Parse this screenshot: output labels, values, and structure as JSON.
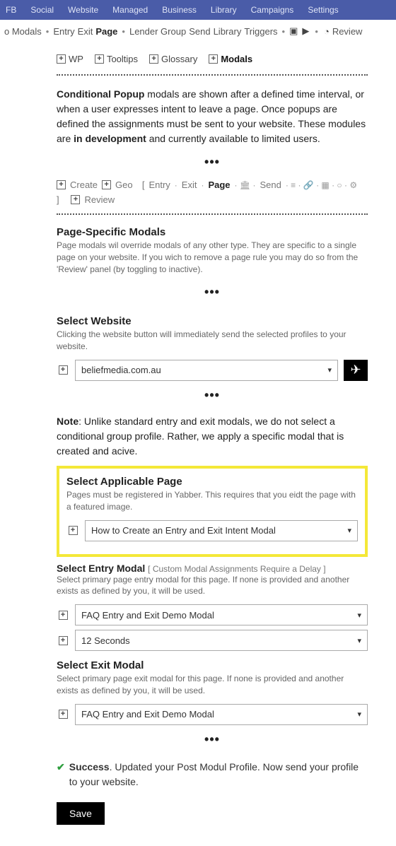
{
  "topnav": [
    "FB",
    "Social",
    "Website",
    "Managed",
    "Business",
    "Library",
    "Campaigns",
    "Settings"
  ],
  "subnav": {
    "left_trunc": "o Modals",
    "items": [
      "Entry",
      "Exit",
      "Page",
      "Lender Group",
      "Send",
      "Library",
      "Triggers"
    ],
    "active": "Page",
    "review": "Review"
  },
  "tabs": {
    "items": [
      "WP",
      "Tooltips",
      "Glossary",
      "Modals"
    ],
    "active": "Modals"
  },
  "intro": {
    "bold1": "Conditional Popup",
    "text1": " modals are shown after a defined time interval, or when a user expresses intent to leave a page. Once popups are defined the assignments must be sent to your website. These modules are ",
    "bold2": "in development",
    "text2": " and currently available to limited users."
  },
  "toolrow": {
    "create": "Create",
    "geo": "Geo",
    "entry": "Entry",
    "exit": "Exit",
    "page": "Page",
    "send": "Send",
    "review": "Review"
  },
  "page_specific": {
    "title": "Page-Specific Modals",
    "help": "Page modals wil override modals of any other type. They are specific to a single page on your website. If you wich to remove a page rule you may do so from the 'Review' panel (by toggling to inactive)."
  },
  "select_website": {
    "title": "Select Website",
    "help": "Clicking the website button will immediately send the selected profiles to your website.",
    "value": "beliefmedia.com.au"
  },
  "note": {
    "bold": "Note",
    "text": ": Unlike standard entry and exit modals, we do not select a conditional group profile. Rather, we apply a specific modal that is created and acive."
  },
  "applicable_page": {
    "title": "Select Applicable Page",
    "help": "Pages must be registered in Yabber. This requires that you eidt the page with a featured image.",
    "value": "How to Create an Entry and Exit Intent Modal"
  },
  "entry_modal": {
    "title": "Select Entry Modal",
    "hint": " [ Custom Modal Assignments Require a Delay ]",
    "help": "Select primary page entry modal for this page. If none is provided and another exists as defined by you, it will be used.",
    "value": "FAQ Entry and Exit Demo Modal",
    "delay": "12 Seconds"
  },
  "exit_modal": {
    "title": "Select Exit Modal",
    "help": "Select primary page exit modal for this page. If none is provided and another exists as defined by you, it will be used.",
    "value": "FAQ Entry and Exit Demo Modal"
  },
  "success": {
    "bold": "Success",
    "text": ". Updated your Post Modul Profile. Now send your profile to your website."
  },
  "save": "Save"
}
